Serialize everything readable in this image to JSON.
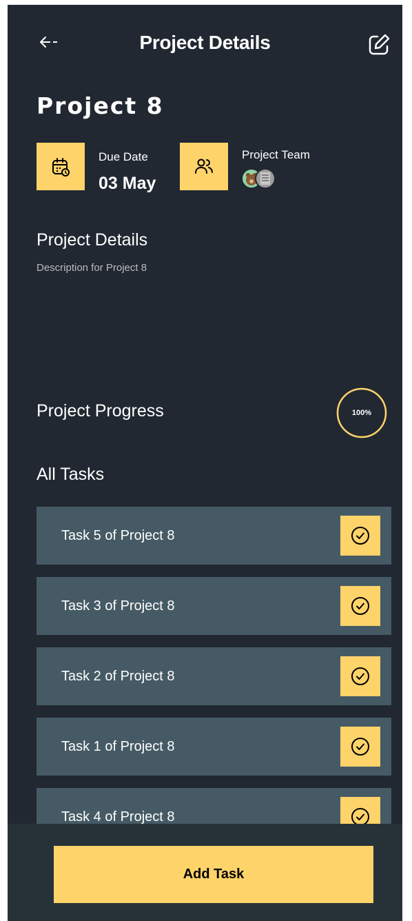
{
  "header": {
    "title": "Project Details",
    "back_icon": "arrow-left-icon",
    "edit_icon": "edit-icon"
  },
  "project": {
    "name": "Project 8",
    "due_date_label": "Due Date",
    "due_date_value": "03 May",
    "team_label": "Project Team",
    "team_avatar_count": 2
  },
  "details": {
    "title": "Project Details",
    "description": "Description for Project 8"
  },
  "progress": {
    "title": "Project Progress",
    "percent_label": "100%",
    "value": 1.0
  },
  "tasks": {
    "title": "All Tasks",
    "items": [
      {
        "label": "Task 5 of Project 8",
        "completed": true
      },
      {
        "label": "Task 3 of Project 8",
        "completed": true
      },
      {
        "label": "Task 2 of Project 8",
        "completed": true
      },
      {
        "label": "Task 1 of Project 8",
        "completed": true
      },
      {
        "label": "Task 4 of Project 8",
        "completed": true
      }
    ]
  },
  "footer": {
    "add_task_label": "Add Task"
  },
  "colors": {
    "background": "#212832",
    "accent": "#FED36A",
    "task_card": "#455A64",
    "footer": "#263238",
    "muted_text": "#BCBCBC"
  }
}
